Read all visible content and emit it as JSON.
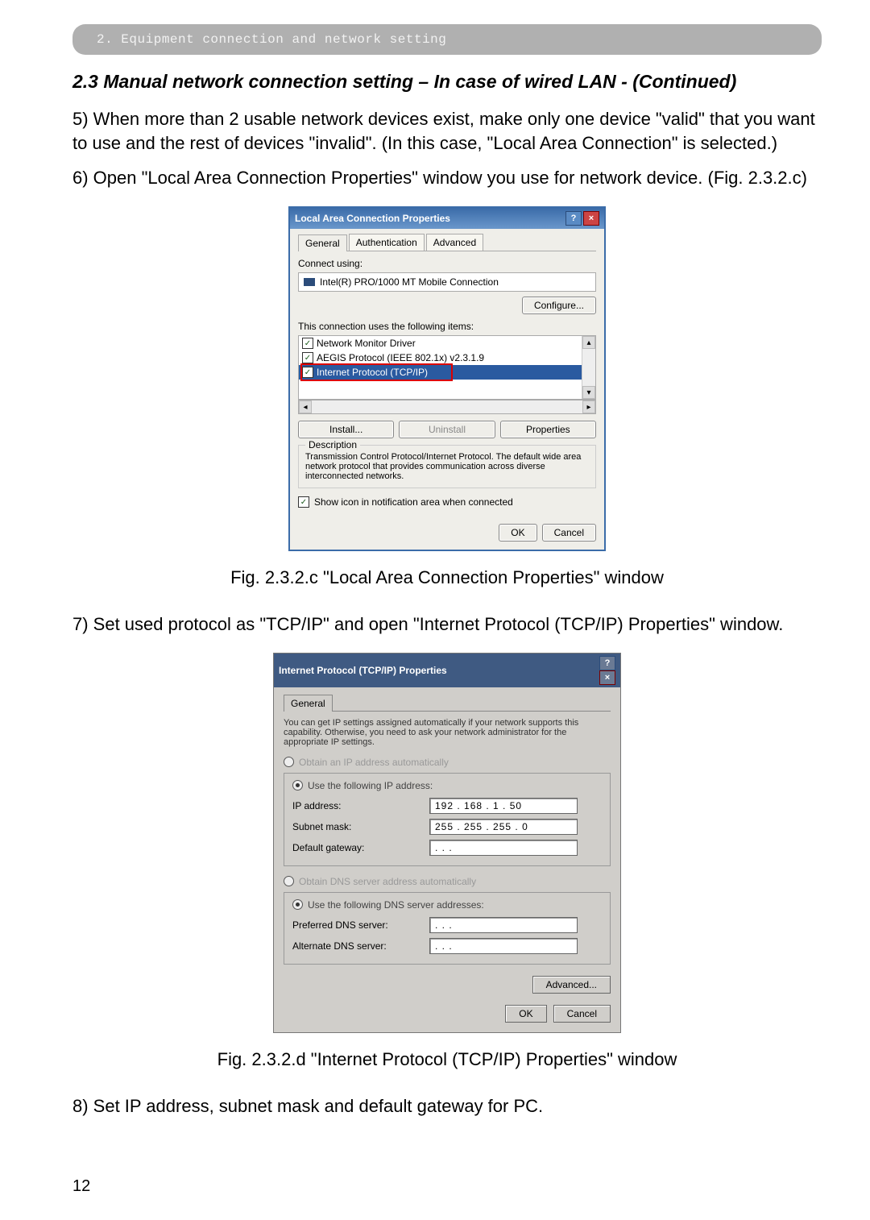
{
  "chapter_banner": "2. Equipment connection and network setting",
  "section_title": "2.3 Manual network connection setting – In case of wired LAN - (Continued)",
  "para5": "5) When more than 2 usable network devices exist, make only one device \"valid\" that you want to use and the rest of devices \"invalid\". (In this case, \"Local Area Connection\" is selected.)",
  "para6": "6) Open \"Local Area Connection Properties\" window you use for network device. (Fig. 2.3.2.c)",
  "fig_c_caption": "Fig. 2.3.2.c \"Local Area Connection Properties\" window",
  "para7": "7) Set used protocol as \"TCP/IP\" and open \"Internet Protocol (TCP/IP) Properties\" window.",
  "fig_d_caption": "Fig. 2.3.2.d \"Internet Protocol (TCP/IP) Properties\" window",
  "para8": "8) Set IP address, subnet mask and default gateway for PC.",
  "page_number": "12",
  "dlg1": {
    "title": "Local Area Connection Properties",
    "tabs": [
      "General",
      "Authentication",
      "Advanced"
    ],
    "connect_using_label": "Connect using:",
    "nic_name": "Intel(R) PRO/1000 MT Mobile Connection",
    "configure_btn": "Configure...",
    "items_label": "This connection uses the following items:",
    "list_items": [
      "Network Monitor Driver",
      "AEGIS Protocol (IEEE 802.1x) v2.3.1.9",
      "Internet Protocol (TCP/IP)"
    ],
    "install_btn": "Install...",
    "uninstall_btn": "Uninstall",
    "properties_btn": "Properties",
    "description_label": "Description",
    "description_text": "Transmission Control Protocol/Internet Protocol. The default wide area network protocol that provides communication across diverse interconnected networks.",
    "show_icon_label": "Show icon in notification area when connected",
    "ok_btn": "OK",
    "cancel_btn": "Cancel"
  },
  "dlg2": {
    "title": "Internet Protocol (TCP/IP) Properties",
    "tab_general": "General",
    "intro": "You can get IP settings assigned automatically if your network supports this capability. Otherwise, you need to ask your network administrator for the appropriate IP settings.",
    "obtain_ip_auto": "Obtain an IP address automatically",
    "use_following_ip": "Use the following IP address:",
    "ip_address_label": "IP address:",
    "ip_address_value": "192 . 168 .   1 .  50",
    "subnet_label": "Subnet mask:",
    "subnet_value": "255 . 255 . 255 .   0",
    "gateway_label": "Default gateway:",
    "gateway_value": "   .     .     .    ",
    "obtain_dns_auto": "Obtain DNS server address automatically",
    "use_following_dns": "Use the following DNS server addresses:",
    "preferred_dns_label": "Preferred DNS server:",
    "alt_dns_label": "Alternate DNS server:",
    "dns_blank": "   .     .     .    ",
    "advanced_btn": "Advanced...",
    "ok_btn": "OK",
    "cancel_btn": "Cancel"
  }
}
